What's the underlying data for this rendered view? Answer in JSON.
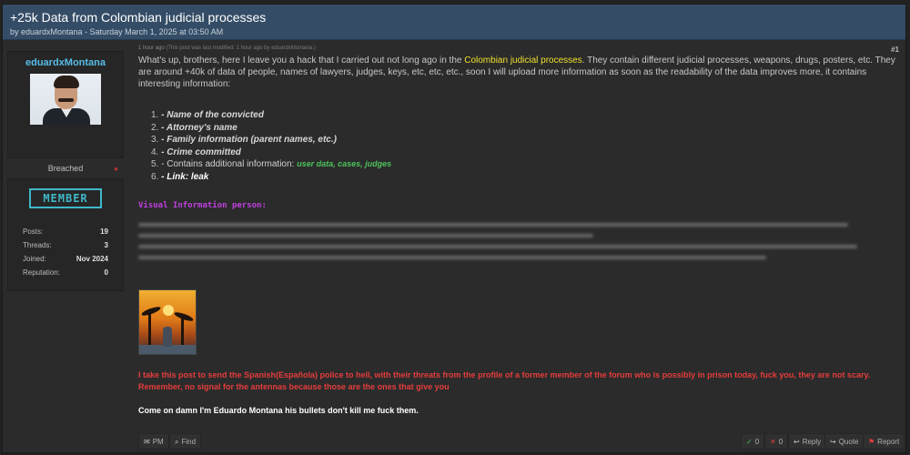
{
  "header": {
    "title": "+25k Data from Colombian judicial processes",
    "meta": "by eduardxMontana - Saturday March 1, 2025 at 03:50 AM"
  },
  "user": {
    "name": "eduardxMontana",
    "rank": "Breached",
    "badge": "MEMBER",
    "stats": [
      {
        "label": "Posts:",
        "value": "19"
      },
      {
        "label": "Threads:",
        "value": "3"
      },
      {
        "label": "Joined:",
        "value": "Nov 2024"
      },
      {
        "label": "Reputation:",
        "value": "0"
      }
    ]
  },
  "post": {
    "time": "1 hour ago",
    "modified": "(This post was last modified: 1 hour ago by eduardxMontana.)",
    "number": "#1",
    "intro_a": "What's up, brothers, here I leave you a hack that I carried out not long ago in the ",
    "intro_hl": "Colombian judicial processes",
    "intro_b": ". They contain different judicial processes, weapons, drugs, posters, etc. They are around +40k of data of people, names of lawyers, judges, keys, etc, etc, etc., soon I will upload more information as soon as the readability of the data improves more, it contains interesting information:",
    "list": {
      "n1": "1.",
      "i1": "- Name of the convicted",
      "n2": "2.",
      "i2": "- Attorney's name",
      "n3": "3.",
      "i3": "- Family information (parent names, etc.)",
      "n4": "4.",
      "i4": "- Crime committed",
      "n5": "5.",
      "i5": "- Contains additional information:",
      "i5b": "user data, cases, judges",
      "n6": "6.",
      "i6": "- Link:",
      "i6b": "leak"
    },
    "visual_title": "Visual Information person:",
    "red_note": "I take this post to send the Spanish(Española) police to hell, with their threats from the profile of a former member of the forum who is possibly in prison today, fuck you, they are not scary. Remember, no signal for the antennas because those are the ones that give you",
    "final": "Come on damn I'm Eduardo Montana his bullets don't kill me fuck them."
  },
  "footer": {
    "pm": "PM",
    "find": "Find",
    "like_count": "0",
    "dislike_count": "0",
    "reply": "Reply",
    "quote": "Quote",
    "report": "Report"
  },
  "colors": {
    "header_bg": "#344c66",
    "username": "#58bde8",
    "highlight": "#f0e030",
    "green": "#4cc35a",
    "purple": "#c040e0",
    "red": "#e53c3c",
    "badge": "#3fb8c9"
  }
}
